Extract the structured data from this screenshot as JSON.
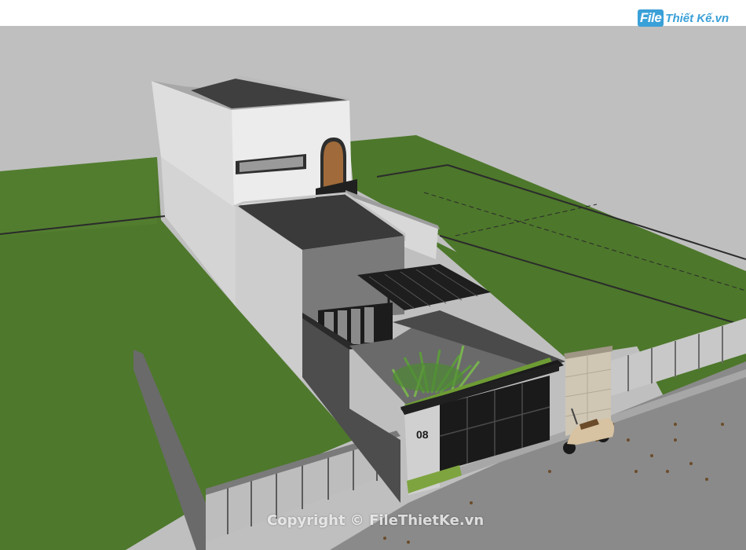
{
  "logo": {
    "file_part": "File",
    "rest_part": "Thiết Kế.vn"
  },
  "watermark": {
    "text": "Copyright © FileThietKe.vn"
  },
  "house_number": "08",
  "colors": {
    "sky": "#bdbdbd",
    "grass": "#4f7a2d",
    "wall_white": "#e6e6e6",
    "wall_dark": "#555555",
    "roof": "#3c3c3c",
    "pavement": "#8a8a8a",
    "stone": "#cfc6b4"
  }
}
